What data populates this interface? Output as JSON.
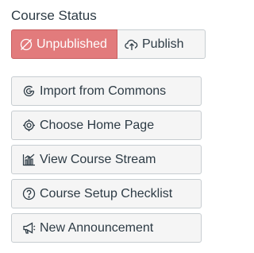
{
  "course_status": {
    "title": "Course Status",
    "unpublished_label": "Unpublished",
    "publish_label": "Publish",
    "colors": {
      "unpublished_bg": "#e27b7c",
      "neutral_bg": "#f5f5f5",
      "border": "#c7cdd1",
      "text": "#2d3b45"
    },
    "icons": {
      "unpublished": "unpublished-icon",
      "publish": "cloud-upload-icon"
    }
  },
  "actions": [
    {
      "label": "Import from Commons",
      "icon": "commons-icon"
    },
    {
      "label": "Choose Home Page",
      "icon": "target-icon"
    },
    {
      "label": "View Course Stream",
      "icon": "chart-icon"
    },
    {
      "label": "Course Setup Checklist",
      "icon": "question-icon"
    },
    {
      "label": "New Announcement",
      "icon": "megaphone-icon"
    }
  ]
}
